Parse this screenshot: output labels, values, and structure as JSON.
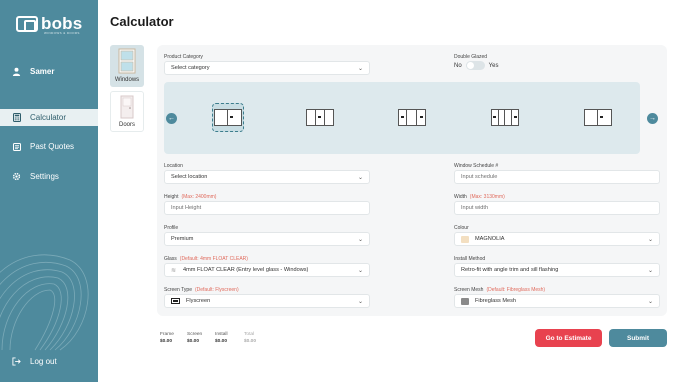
{
  "brand": {
    "name": "bobs",
    "tagline": "WINDOWS & DOORS"
  },
  "user": {
    "name": "Samer"
  },
  "nav": [
    {
      "label": "Calculator",
      "icon": "calculator-icon",
      "active": true
    },
    {
      "label": "Past Quotes",
      "icon": "list-icon",
      "active": false
    },
    {
      "label": "Settings",
      "icon": "gear-icon",
      "active": false
    }
  ],
  "logout_label": "Log out",
  "page_title": "Calculator",
  "product_types": [
    {
      "label": "Windows",
      "selected": true
    },
    {
      "label": "Doors",
      "selected": false
    }
  ],
  "form": {
    "product_category": {
      "label": "Product Category",
      "value": "Select category"
    },
    "double_glazed": {
      "label": "Double Glazed",
      "off_label": "No",
      "on_label": "Yes",
      "value": false
    },
    "location": {
      "label": "Location",
      "value": "Select location"
    },
    "window_schedule": {
      "label": "Window Schedule #",
      "placeholder": "Input schedule"
    },
    "height": {
      "label": "Height",
      "hint": "(Max: 2400mm)",
      "placeholder": "Input Height"
    },
    "width": {
      "label": "Width",
      "hint": "(Max: 3130mm)",
      "placeholder": "Input width"
    },
    "profile": {
      "label": "Profile",
      "value": "Premium"
    },
    "colour": {
      "label": "Colour",
      "value": "MAGNOLIA",
      "swatch": "#f3dfc1"
    },
    "glass": {
      "label": "Glass",
      "hint": "(Default: 4mm FLOAT CLEAR)",
      "value": "4mm FLOAT CLEAR (Entry level glass - Windows)"
    },
    "install_method": {
      "label": "Install Method",
      "value": "Retro-fit with angle trim and sill flashing"
    },
    "screen_type": {
      "label": "Screen Type",
      "hint": "(Default: Flyscreen)",
      "value": "Flyscreen"
    },
    "screen_mesh": {
      "label": "Screen Mesh",
      "hint": "(Default: Fibreglass Mesh)",
      "value": "Fibreglass Mesh",
      "swatch": "#8a8a8a"
    }
  },
  "totals": [
    {
      "label": "Frame",
      "value": "$0.00"
    },
    {
      "label": "Screen",
      "value": "$0.00"
    },
    {
      "label": "Install",
      "value": "$0.00"
    },
    {
      "label": "Total",
      "value": "$0.00"
    }
  ],
  "buttons": {
    "estimate": {
      "label": "Go to Estimate",
      "color": "#e8424f"
    },
    "submit": {
      "label": "Submit",
      "color": "#4e8a9d"
    }
  },
  "colors": {
    "sidebar": "#4e8a9d",
    "accent": "#4e8a9d",
    "danger": "#e8424f"
  }
}
